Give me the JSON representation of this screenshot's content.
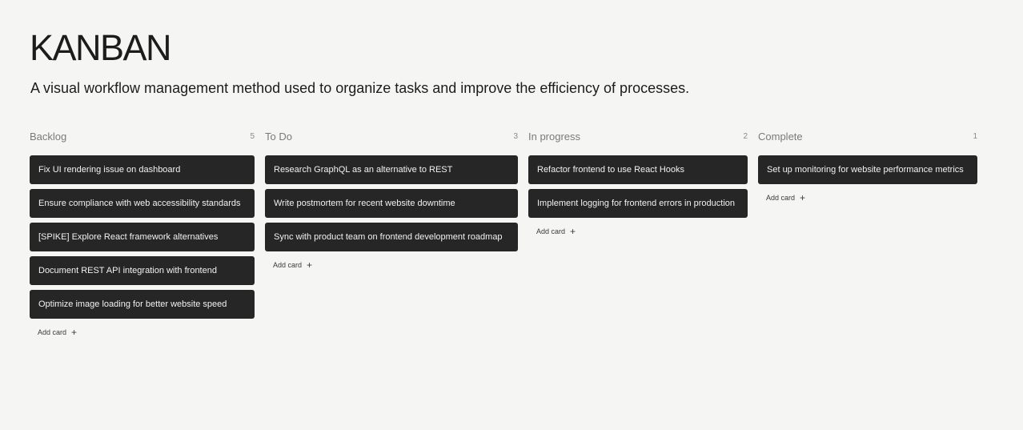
{
  "header": {
    "title": "KANBAN",
    "subtitle": "A visual workflow management method used to organize tasks and improve the efficiency of processes."
  },
  "columns": [
    {
      "title": "Backlog",
      "count": "5",
      "cards": [
        "Fix UI rendering issue on dashboard",
        "Ensure compliance with web accessibility standards",
        "[SPIKE] Explore React framework alternatives",
        "Document REST API integration with frontend",
        "Optimize image loading for better website speed"
      ],
      "add_label": "Add card"
    },
    {
      "title": "To Do",
      "count": "3",
      "cards": [
        "Research GraphQL as an alternative to REST",
        "Write postmortem for recent website downtime",
        "Sync with product team on frontend development roadmap"
      ],
      "add_label": "Add card"
    },
    {
      "title": "In progress",
      "count": "2",
      "cards": [
        "Refactor frontend to use React Hooks",
        "Implement logging for frontend errors in production"
      ],
      "add_label": "Add card"
    },
    {
      "title": "Complete",
      "count": "1",
      "cards": [
        "Set up monitoring for website performance metrics"
      ],
      "add_label": "Add card"
    }
  ],
  "icons": {
    "add": "plus-icon"
  }
}
